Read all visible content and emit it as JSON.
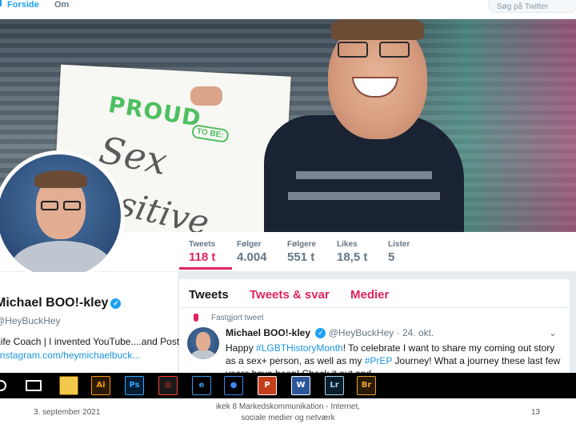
{
  "topnav": {
    "home_label": "Forside",
    "about_label": "Om",
    "search_placeholder": "Søg på Twitter"
  },
  "header": {
    "sign_line1": "PROUD",
    "sign_badge": "TO BE:",
    "sign_line2": "Sex",
    "sign_line3": "Positive"
  },
  "stats": [
    {
      "label": "Tweets",
      "value": "118 t"
    },
    {
      "label": "Følger",
      "value": "4.004"
    },
    {
      "label": "Følgere",
      "value": "551 t"
    },
    {
      "label": "Likes",
      "value": "18,5 t"
    },
    {
      "label": "Lister",
      "value": "5"
    }
  ],
  "profile": {
    "name": "Michael BOO!-kley",
    "handle": "@HeyBuckHey",
    "bio": "Life Coach | I invented YouTube....and Post",
    "link": "instagram.com/heymichaelbuck..."
  },
  "tabs": [
    "Tweets",
    "Tweets & svar",
    "Medier"
  ],
  "tweet": {
    "pinned_label": "Fastgjort tweet",
    "author": "Michael BOO!-kley",
    "handle": "@HeyBuckHey",
    "date": "· 24. okt.",
    "text_before": "Happy ",
    "hashtag1": "#LGBTHistoryMonth",
    "text_mid": "! To celebrate I want to share my coming out story as a sex+ person, as well as my ",
    "hashtag2": "#PrEP",
    "text_after": " Journey! What a journey these last few years have been! Check it out and..."
  },
  "taskbar": {
    "apps": [
      {
        "name": "file-explorer",
        "glyph": "",
        "bg": "#f2c94c",
        "fg": "#7a5a00"
      },
      {
        "name": "illustrator",
        "glyph": "Ai",
        "bg": "#2b1a06",
        "fg": "#ff9a00"
      },
      {
        "name": "photoshop",
        "glyph": "Ps",
        "bg": "#061d33",
        "fg": "#31a8ff"
      },
      {
        "name": "creative-cloud",
        "glyph": "◎",
        "bg": "#1a1a1a",
        "fg": "#ff3b30"
      },
      {
        "name": "edge",
        "glyph": "e",
        "bg": "#000000",
        "fg": "#3c9ae8"
      },
      {
        "name": "chrome",
        "glyph": "●",
        "bg": "#000000",
        "fg": "#4285f4"
      },
      {
        "name": "powerpoint",
        "glyph": "P",
        "bg": "#c43e1c",
        "fg": "#ffffff"
      },
      {
        "name": "word",
        "glyph": "W",
        "bg": "#2b579a",
        "fg": "#ffffff"
      },
      {
        "name": "lightroom",
        "glyph": "Lr",
        "bg": "#0a1e2e",
        "fg": "#add5ec"
      },
      {
        "name": "bridge",
        "glyph": "Br",
        "bg": "#2a1a00",
        "fg": "#e8a33d"
      }
    ]
  },
  "footer": {
    "date": "3. september 2021",
    "title_line1": "ikek 8 Markedskommunikation - Internet,",
    "title_line2": "sociale medier og netværk",
    "page": "13"
  }
}
